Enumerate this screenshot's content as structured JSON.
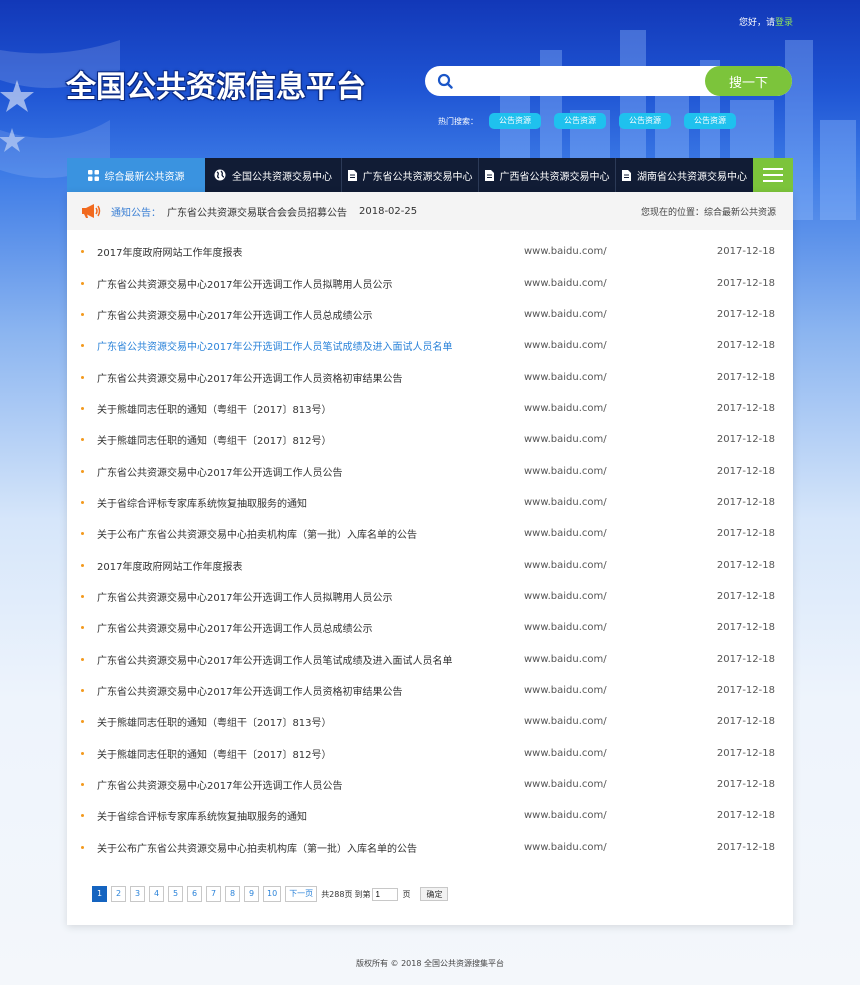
{
  "header": {
    "greeting": "您好，请",
    "login_link": "登录",
    "logo_text": "全国公共资源信息平台"
  },
  "search": {
    "placeholder": "",
    "button_label": "搜一下",
    "hot_label": "热门搜索：",
    "hot_tags": [
      "公告资源",
      "公告资源",
      "公告资源",
      "公告资源"
    ]
  },
  "nav": {
    "items": [
      {
        "label": "综合最新公共资源",
        "icon": "grid-icon"
      },
      {
        "label": "全国公共资源交易中心",
        "icon": "globe-icon"
      },
      {
        "label": "广东省公共资源交易中心",
        "icon": "document-icon"
      },
      {
        "label": "广西省公共资源交易中心",
        "icon": "document-icon"
      },
      {
        "label": "湖南省公共资源交易中心",
        "icon": "document-icon"
      }
    ],
    "menu_icon": "hamburger-icon"
  },
  "notice": {
    "label": "通知公告：",
    "text": "广东省公共资源交易联合会会员招募公告",
    "date": "2018-02-25",
    "location": "您现在的位置：综合最新公共资源"
  },
  "list": [
    {
      "title": "2017年度政府网站工作年度报表",
      "url": "www.baidu.com/",
      "date": "2017-12-18"
    },
    {
      "title": "广东省公共资源交易中心2017年公开选调工作人员拟聘用人员公示",
      "url": "www.baidu.com/",
      "date": "2017-12-18"
    },
    {
      "title": "广东省公共资源交易中心2017年公开选调工作人员总成绩公示",
      "url": "www.baidu.com/",
      "date": "2017-12-18"
    },
    {
      "title": "广东省公共资源交易中心2017年公开选调工作人员笔试成绩及进入面试人员名单",
      "url": "www.baidu.com/",
      "date": "2017-12-18"
    },
    {
      "title": "广东省公共资源交易中心2017年公开选调工作人员资格初审结果公告",
      "url": "www.baidu.com/",
      "date": "2017-12-18"
    },
    {
      "title": "关于熊雄同志任职的通知（粤组干〔2017〕813号）",
      "url": "www.baidu.com/",
      "date": "2017-12-18"
    },
    {
      "title": "关于熊雄同志任职的通知（粤组干〔2017〕812号）",
      "url": "www.baidu.com/",
      "date": "2017-12-18"
    },
    {
      "title": "广东省公共资源交易中心2017年公开选调工作人员公告",
      "url": "www.baidu.com/",
      "date": "2017-12-18"
    },
    {
      "title": "关于省综合评标专家库系统恢复抽取服务的通知",
      "url": "www.baidu.com/",
      "date": "2017-12-18"
    },
    {
      "title": "关于公布广东省公共资源交易中心拍卖机构库（第一批）入库名单的公告",
      "url": "www.baidu.com/",
      "date": "2017-12-18"
    },
    {
      "title": "2017年度政府网站工作年度报表",
      "url": "www.baidu.com/",
      "date": "2017-12-18"
    },
    {
      "title": "广东省公共资源交易中心2017年公开选调工作人员拟聘用人员公示",
      "url": "www.baidu.com/",
      "date": "2017-12-18"
    },
    {
      "title": "广东省公共资源交易中心2017年公开选调工作人员总成绩公示",
      "url": "www.baidu.com/",
      "date": "2017-12-18"
    },
    {
      "title": "广东省公共资源交易中心2017年公开选调工作人员笔试成绩及进入面试人员名单",
      "url": "www.baidu.com/",
      "date": "2017-12-18"
    },
    {
      "title": "广东省公共资源交易中心2017年公开选调工作人员资格初审结果公告",
      "url": "www.baidu.com/",
      "date": "2017-12-18"
    },
    {
      "title": "关于熊雄同志任职的通知（粤组干〔2017〕813号）",
      "url": "www.baidu.com/",
      "date": "2017-12-18"
    },
    {
      "title": "关于熊雄同志任职的通知（粤组干〔2017〕812号）",
      "url": "www.baidu.com/",
      "date": "2017-12-18"
    },
    {
      "title": "广东省公共资源交易中心2017年公开选调工作人员公告",
      "url": "www.baidu.com/",
      "date": "2017-12-18"
    },
    {
      "title": "关于省综合评标专家库系统恢复抽取服务的通知",
      "url": "www.baidu.com/",
      "date": "2017-12-18"
    },
    {
      "title": "关于公布广东省公共资源交易中心拍卖机构库（第一批）入库名单的公告",
      "url": "www.baidu.com/",
      "date": "2017-12-18"
    }
  ],
  "highlight_index": 3,
  "pager": {
    "pages": [
      "1",
      "2",
      "3",
      "4",
      "5",
      "6",
      "7",
      "8",
      "9",
      "10"
    ],
    "current": "1",
    "next_label": "下一页",
    "total_text": "共288页",
    "goto_text": "到第",
    "goto_value": "1",
    "page_unit": "页",
    "confirm_label": "确定"
  },
  "footer": {
    "text": "版权所有 © 2018 全国公共资源搜集平台"
  },
  "colors": {
    "accent_green": "#7cc43b",
    "accent_blue": "#3a93e0",
    "nav_dark": "#111c35",
    "link_blue": "#2b83d9",
    "bullet_orange": "#f39a1e"
  }
}
